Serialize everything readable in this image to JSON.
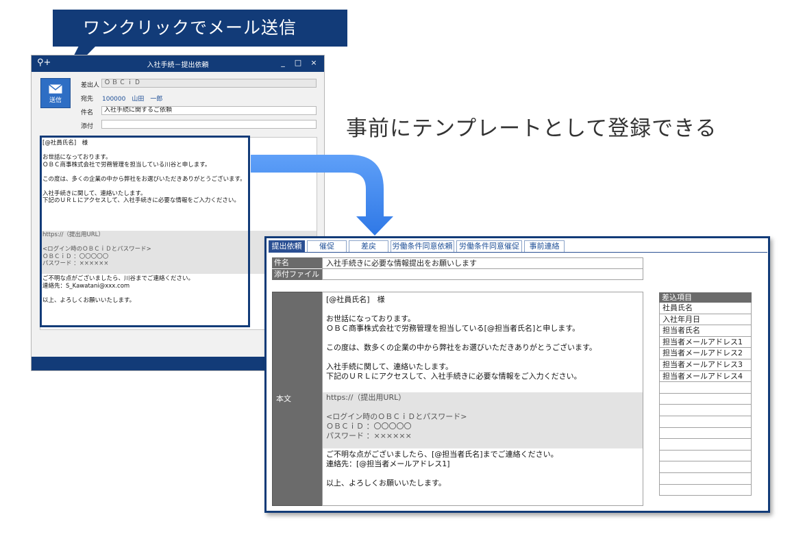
{
  "callout": {
    "text": "ワンクリックでメール送信"
  },
  "headline": "事前にテンプレートとして登録できる",
  "back_window": {
    "title": "入社手続－提出依頼",
    "controls": {
      "minimize": "_",
      "maximize": "□",
      "close": "×"
    },
    "send_button": {
      "label": "送信",
      "icon": "envelope-icon"
    },
    "fields": {
      "from_label": "差出人",
      "from_value": "ＯＢＣｉＤ",
      "to_label": "宛先",
      "to_value": "100000　山田　一郎",
      "subject_label": "件名",
      "subject_value": "入社手続に関するご依頼",
      "attach_label": "添付",
      "attach_value": ""
    },
    "body": {
      "part1": "[@社員氏名]　様\n\nお世話になっております。\nＯＢＣ商事株式会社で労務管理を担当している川谷と申します。\n\nこの度は、多くの企業の中から弊社をお選びいただきありがとうございます。\n\n入社手続きに関して、連絡いたします。\n下記のＵＲＬにアクセスして、入社手続きに必要な情報をご入力ください。",
      "part2": "https://（提出用URL）\n\n<ログイン時のＯＢＣｉＤとパスワード>\nＯＢＣｉＤ ：〇〇〇〇〇\nパスワード ：××××××",
      "part3": "ご不明な点がございましたら、川谷までご連絡ください。\n連絡先：S_Kawatani@xxx.com\n\n以上、よろしくお願いいたします。"
    }
  },
  "front_panel": {
    "tabs": [
      {
        "label": "提出依頼",
        "active": true
      },
      {
        "label": "催促",
        "active": false
      },
      {
        "label": "差戻",
        "active": false
      },
      {
        "label": "労働条件同意依頼",
        "active": false
      },
      {
        "label": "労働条件同意催促",
        "active": false
      },
      {
        "label": "事前連絡",
        "active": false
      }
    ],
    "subject_label": "件名",
    "subject_value": "入社手続きに必要な情報提出をお願いします",
    "attach_label": "添付ファイル",
    "attach_value": "",
    "body_label": "本文",
    "body": {
      "part1": "[@社員氏名]　様\n\nお世話になっております。\nＯＢＣ商事株式会社で労務管理を担当している[@担当者氏名]と申します。\n\nこの度は、数多くの企業の中から弊社をお選びいただきありがとうございます。\n\n入社手続に関して、連絡いたします。\n下記のＵＲＬにアクセスして、入社手続きに必要な情報をご入力ください。",
      "part2": "https://（提出用URL）\n\n<ログイン時のＯＢＣｉＤとパスワード>\nＯＢＣｉＤ ：〇〇〇〇〇\nパスワード ：××××××",
      "part3": "ご不明な点がございましたら、[@担当者氏名]までご連絡ください。\n連絡先：[@担当者メールアドレス1]\n\n以上、よろしくお願いいたします。"
    },
    "merge_title": "差込項目",
    "merge_items": [
      "社員氏名",
      "入社年月日",
      "担当者氏名",
      "担当者メールアドレス1",
      "担当者メールアドレス2",
      "担当者メールアドレス3",
      "担当者メールアドレス4",
      "",
      "",
      "",
      "",
      "",
      "",
      "",
      "",
      "",
      ""
    ]
  },
  "colors": {
    "navy": "#123b78",
    "arrow_blue": "#3d86f0",
    "header_gray": "#6b6b6b"
  }
}
